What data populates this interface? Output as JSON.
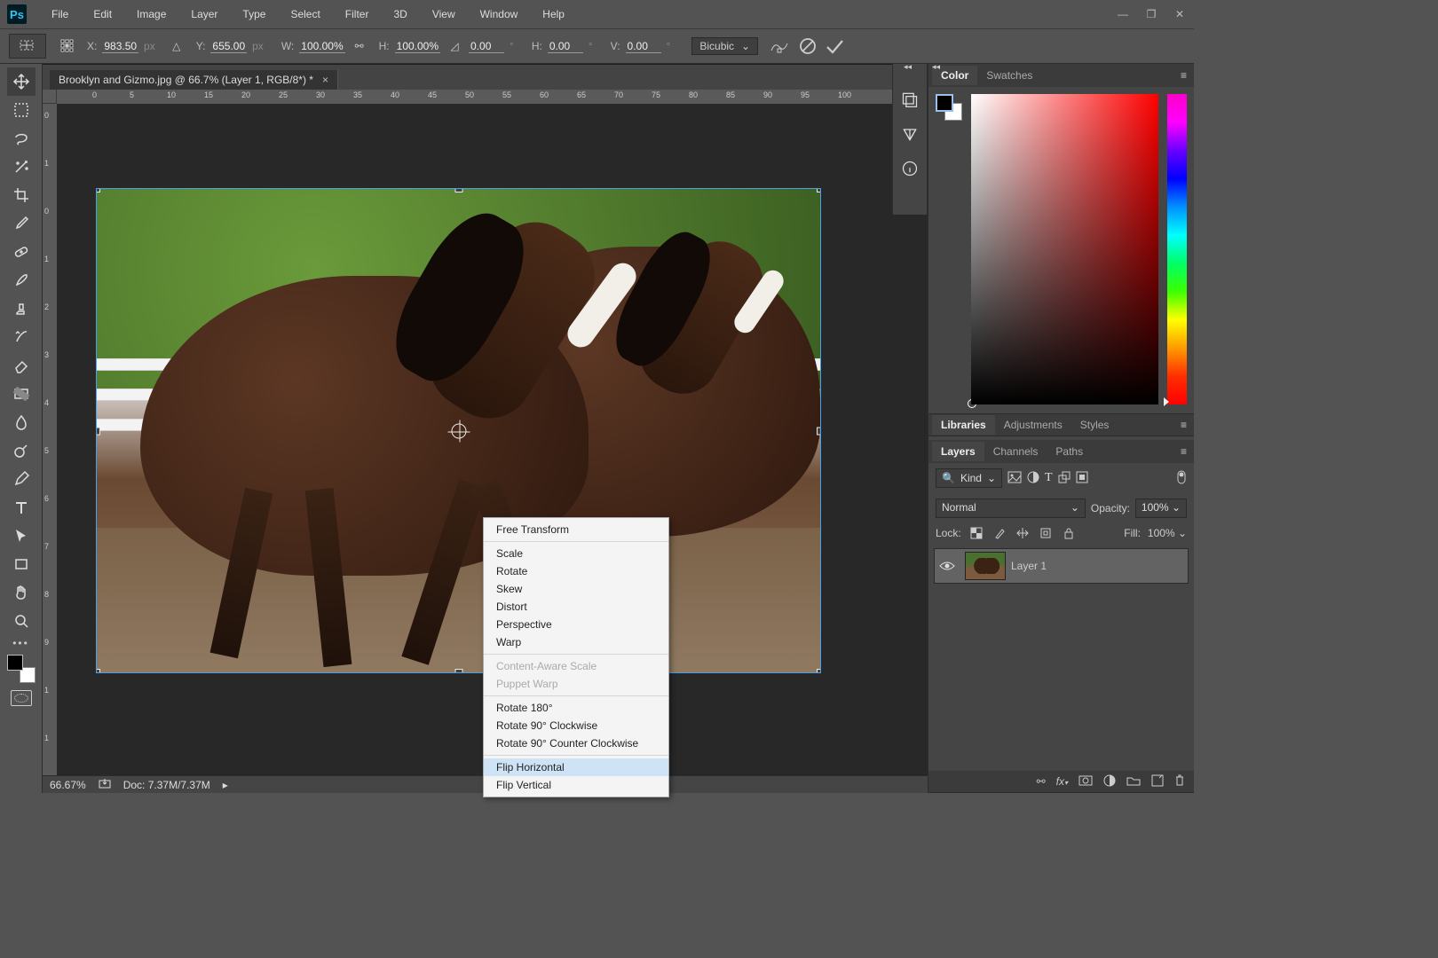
{
  "menubar": [
    "File",
    "Edit",
    "Image",
    "Layer",
    "Type",
    "Select",
    "Filter",
    "3D",
    "View",
    "Window",
    "Help"
  ],
  "options": {
    "x_label": "X:",
    "x_val": "983.50",
    "x_unit": "px",
    "y_label": "Y:",
    "y_val": "655.00",
    "y_unit": "px",
    "w_label": "W:",
    "w_val": "100.00%",
    "h_label": "H:",
    "h_val": "100.00%",
    "angle_val": "0.00",
    "angle_unit": "°",
    "hskew_label": "H:",
    "hskew_val": "0.00",
    "hskew_unit": "°",
    "vskew_label": "V:",
    "vskew_val": "0.00",
    "vskew_unit": "°",
    "interp": "Bicubic"
  },
  "tab_title": "Brooklyn and Gizmo.jpg @ 66.7% (Layer 1, RGB/8*) *",
  "ruler_h": [
    "0",
    "5",
    "10",
    "15",
    "20",
    "25",
    "30",
    "35",
    "40",
    "45",
    "50",
    "55",
    "60",
    "65",
    "70",
    "75",
    "80",
    "85",
    "90",
    "95",
    "100"
  ],
  "ruler_v": [
    "0",
    "1",
    "0",
    "1",
    "2",
    "3",
    "4",
    "5",
    "6",
    "7",
    "8",
    "9",
    "1",
    "1"
  ],
  "context_menu": [
    {
      "label": "Free Transform"
    },
    {
      "sep": true
    },
    {
      "label": "Scale"
    },
    {
      "label": "Rotate"
    },
    {
      "label": "Skew"
    },
    {
      "label": "Distort"
    },
    {
      "label": "Perspective"
    },
    {
      "label": "Warp"
    },
    {
      "sep": true
    },
    {
      "label": "Content-Aware Scale",
      "disabled": true
    },
    {
      "label": "Puppet Warp",
      "disabled": true
    },
    {
      "sep": true
    },
    {
      "label": "Rotate 180°"
    },
    {
      "label": "Rotate 90° Clockwise"
    },
    {
      "label": "Rotate 90° Counter Clockwise"
    },
    {
      "sep": true
    },
    {
      "label": "Flip Horizontal",
      "hl": true
    },
    {
      "label": "Flip Vertical"
    }
  ],
  "panels": {
    "color_tabs": [
      "Color",
      "Swatches"
    ],
    "mid_tabs": [
      "Libraries",
      "Adjustments",
      "Styles"
    ],
    "layer_tabs": [
      "Layers",
      "Channels",
      "Paths"
    ],
    "filter_by": "Kind",
    "blend_mode": "Normal",
    "opacity_label": "Opacity:",
    "opacity_val": "100%",
    "lock_label": "Lock:",
    "fill_label": "Fill:",
    "fill_val": "100%",
    "layer_name": "Layer 1"
  },
  "status": {
    "zoom": "66.67%",
    "doc": "Doc: 7.37M/7.37M"
  },
  "tools": [
    {
      "name": "move-tool",
      "svg": "move"
    },
    {
      "name": "marquee-tool",
      "svg": "marquee"
    },
    {
      "name": "lasso-tool",
      "svg": "lasso"
    },
    {
      "name": "quick-select-tool",
      "svg": "wand"
    },
    {
      "name": "crop-tool",
      "svg": "crop"
    },
    {
      "name": "eyedropper-tool",
      "svg": "eyedrop"
    },
    {
      "name": "healing-brush-tool",
      "svg": "bandaid"
    },
    {
      "name": "brush-tool",
      "svg": "brush"
    },
    {
      "name": "clone-stamp-tool",
      "svg": "stamp"
    },
    {
      "name": "history-brush-tool",
      "svg": "histbrush"
    },
    {
      "name": "eraser-tool",
      "svg": "eraser"
    },
    {
      "name": "gradient-tool",
      "svg": "gradient"
    },
    {
      "name": "blur-tool",
      "svg": "drop"
    },
    {
      "name": "dodge-tool",
      "svg": "dodge"
    },
    {
      "name": "pen-tool",
      "svg": "pen"
    },
    {
      "name": "type-tool",
      "svg": "type"
    },
    {
      "name": "path-select-tool",
      "svg": "pathsel"
    },
    {
      "name": "rectangle-tool",
      "svg": "rect"
    },
    {
      "name": "hand-tool",
      "svg": "hand"
    },
    {
      "name": "zoom-tool",
      "svg": "zoom"
    }
  ]
}
